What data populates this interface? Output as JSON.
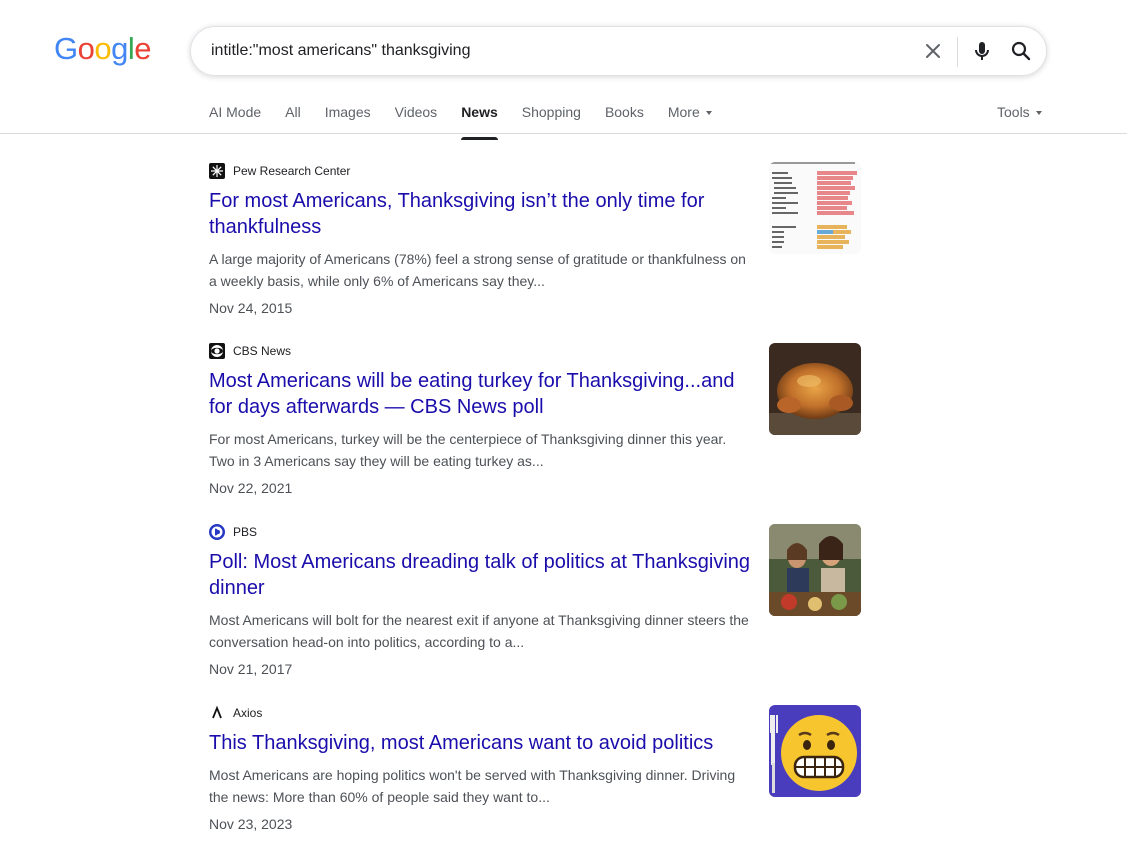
{
  "search": {
    "query": "intitle:\"most americans\" thanksgiving",
    "logo": "Google"
  },
  "tabs": [
    {
      "label": "AI Mode"
    },
    {
      "label": "All"
    },
    {
      "label": "Images"
    },
    {
      "label": "Videos"
    },
    {
      "label": "News",
      "active": true
    },
    {
      "label": "Shopping"
    },
    {
      "label": "Books"
    },
    {
      "label": "More"
    }
  ],
  "tools_label": "Tools",
  "results": [
    {
      "source": "Pew Research Center",
      "title": "For most Americans, Thanksgiving isn’t the only time for thankfulness",
      "snippet": "A large majority of Americans (78%) feel a strong sense of gratitude or thankfulness on a weekly basis, while only 6% of Americans say they...",
      "date": "Nov 24, 2015",
      "thumbnail": "bar-chart-image"
    },
    {
      "source": "CBS News",
      "title": "Most Americans will be eating turkey for Thanksgiving...and for days afterwards — CBS News poll",
      "snippet": "For most Americans, turkey will be the centerpiece of Thanksgiving dinner this year. Two in 3 Americans say they will be eating turkey as...",
      "date": "Nov 22, 2021",
      "thumbnail": "roast-turkey-image"
    },
    {
      "source": "PBS",
      "title": "Poll: Most Americans dreading talk of politics at Thanksgiving dinner",
      "snippet": "Most Americans will bolt for the nearest exit if anyone at Thanksgiving dinner steers the conversation head-on into politics, according to a...",
      "date": "Nov 21, 2017",
      "thumbnail": "dinner-table-image"
    },
    {
      "source": "Axios",
      "title": "This Thanksgiving, most Americans want to avoid politics",
      "snippet": "Most Americans are hoping politics won't be served with Thanksgiving dinner. Driving the news: More than 60% of people said they want to...",
      "date": "Nov 23, 2023",
      "thumbnail": "grimacing-emoji-image"
    }
  ],
  "colors": {
    "link": "#1a0dab",
    "snippet": "#4d5156",
    "axios_bg": "#4a3dbd",
    "google_blue": "#4285f4",
    "google_red": "#ea4335",
    "google_yellow": "#fbbc05",
    "google_green": "#34a853"
  }
}
